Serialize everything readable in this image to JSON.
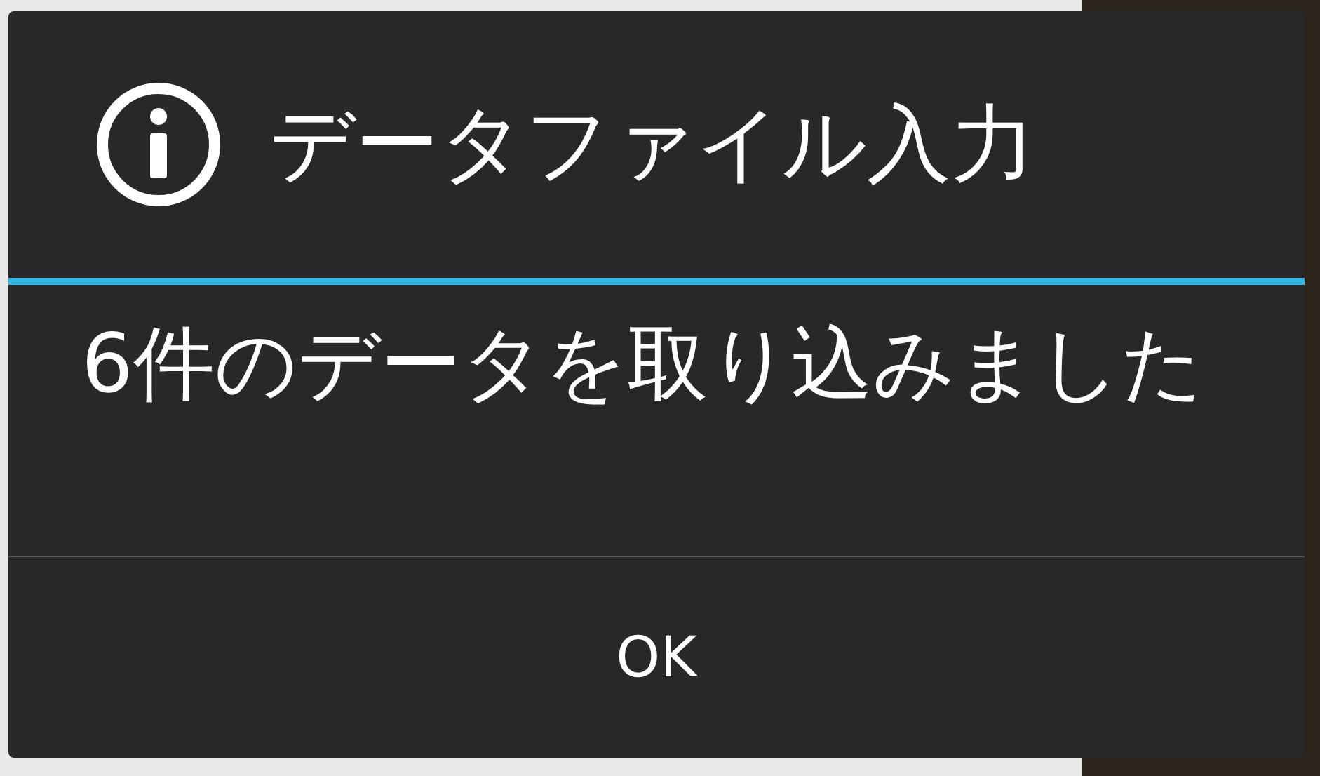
{
  "dialog": {
    "title": "データファイル入力",
    "message": "6件のデータを取り込みました",
    "buttons": [
      "OK"
    ]
  }
}
